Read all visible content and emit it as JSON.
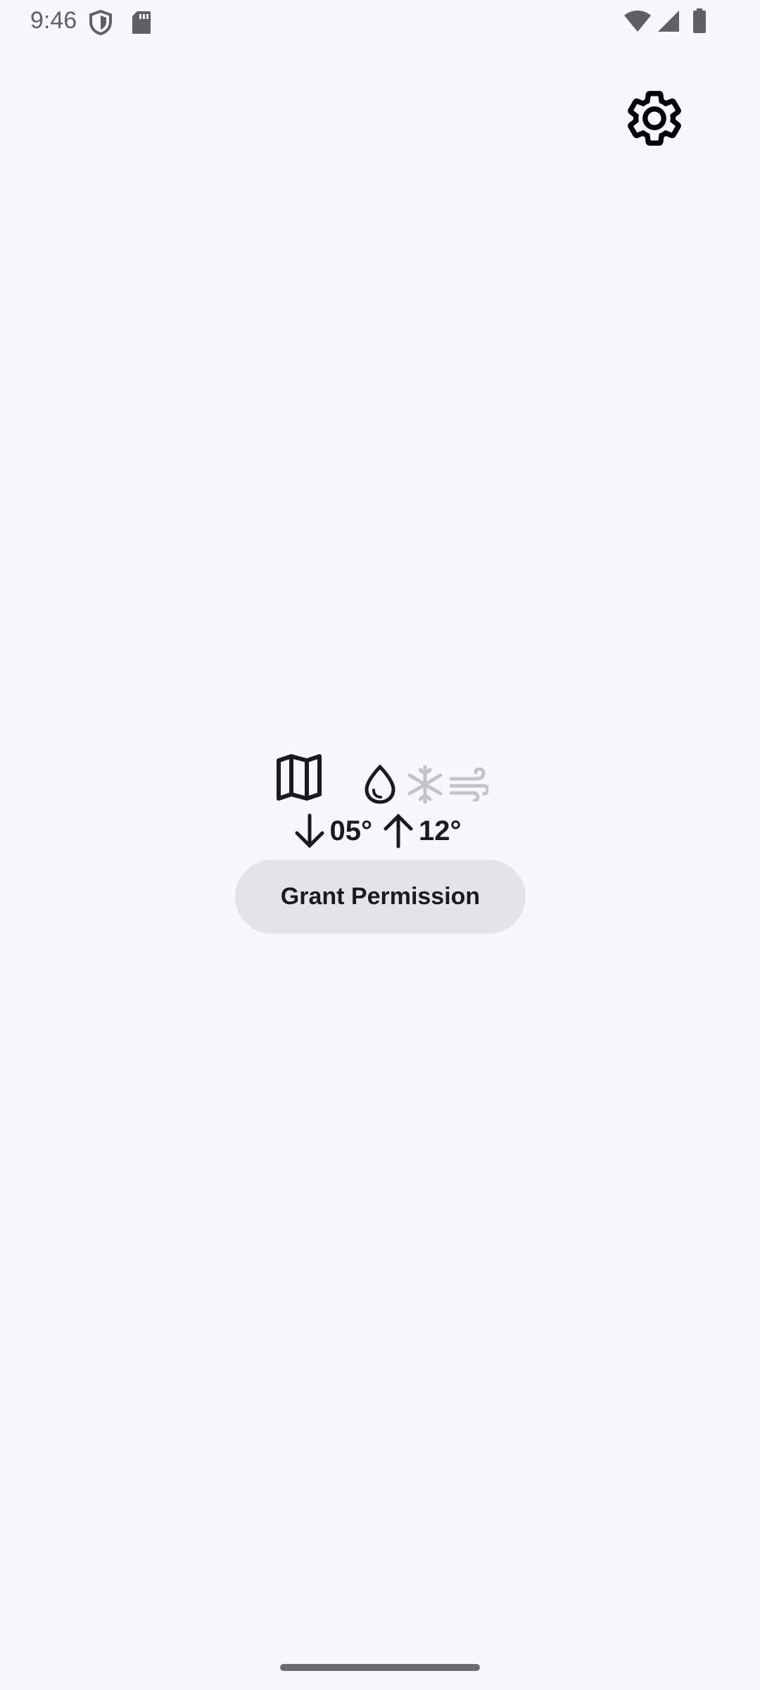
{
  "status_bar": {
    "time": "9:46",
    "icons": [
      "shield-icon",
      "sd-card-icon",
      "wifi-icon",
      "cell-signal-icon",
      "battery-icon"
    ]
  },
  "settings": {
    "icon": "gear-icon"
  },
  "weather": {
    "icons": [
      "map-icon",
      "water-drop-icon",
      "snowflake-icon",
      "wind-icon"
    ],
    "low_temp": "05°",
    "high_temp": "12°"
  },
  "permission": {
    "button_label": "Grant Permission"
  },
  "colors": {
    "background": "#f8f7fd",
    "button_bg": "#e4e3ea",
    "text": "#1b1b1f",
    "muted_icon": "#c4c3c9"
  }
}
